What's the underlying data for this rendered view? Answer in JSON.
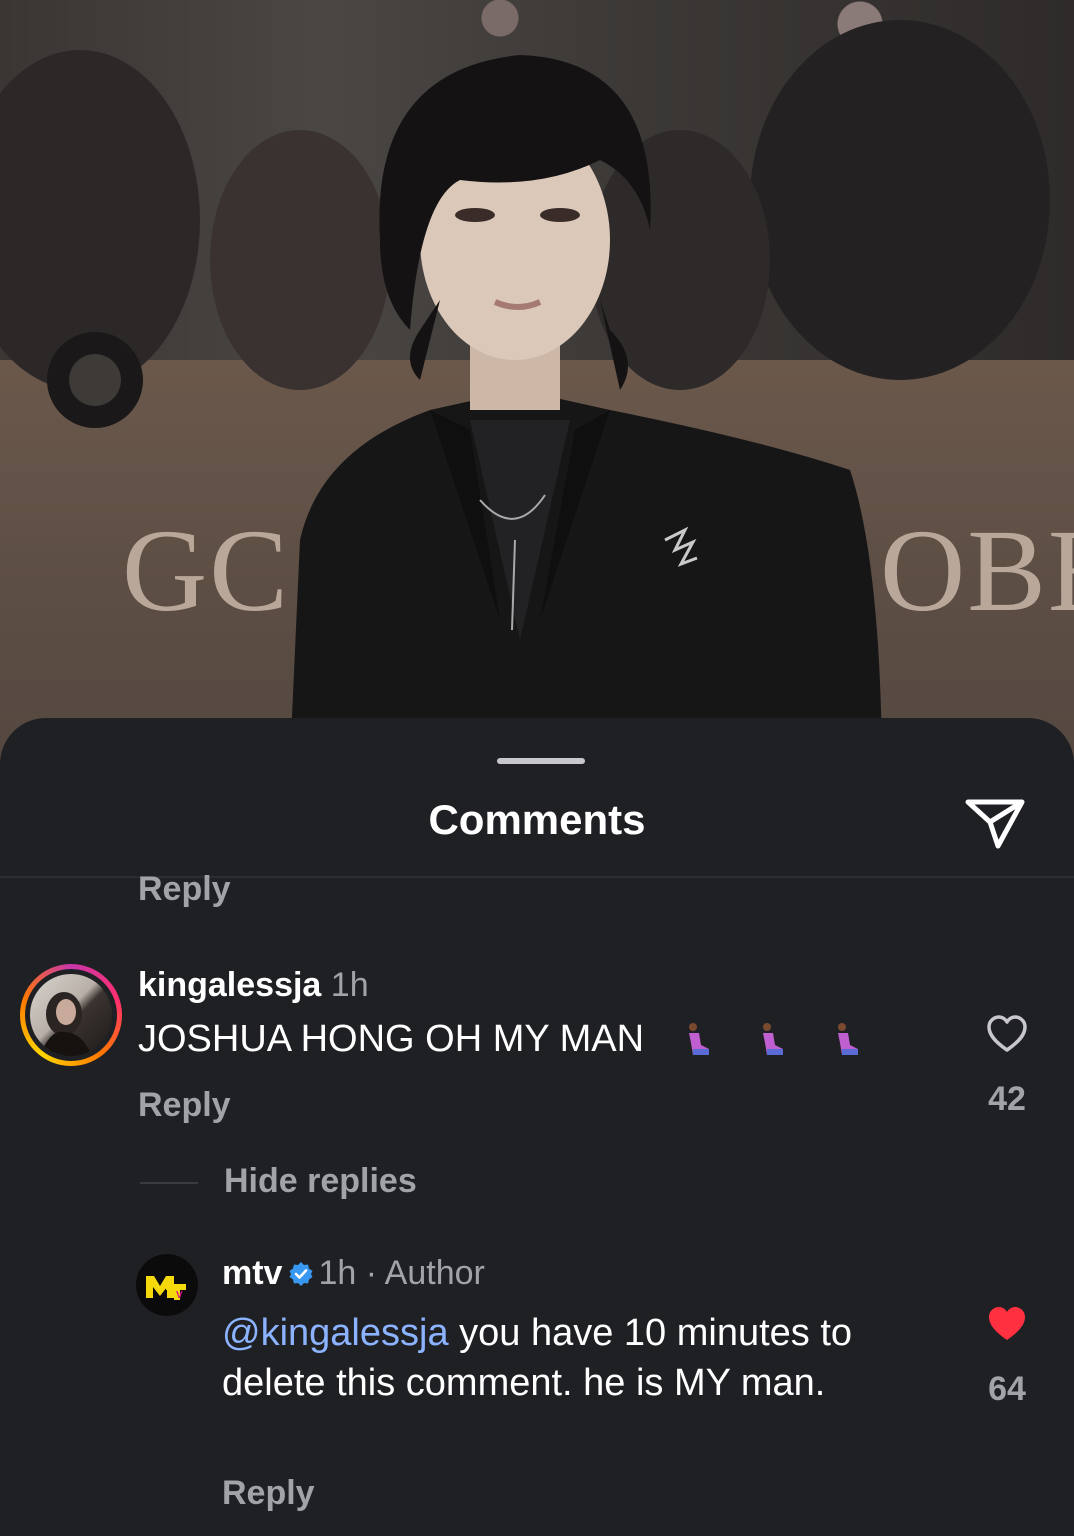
{
  "photo": {
    "board_text_left": "GC",
    "board_text_right": "OBE"
  },
  "sheet": {
    "title": "Comments",
    "share_icon": "paper-plane-icon"
  },
  "comments": [
    {
      "username": "kingalessja",
      "time": "1h",
      "text": "JOSHUA HONG OH MY MAN",
      "emoji": "person-kneeling",
      "reply_label": "Reply",
      "like_count": "42",
      "liked": false
    }
  ],
  "thread": {
    "prev_reply_label": "Reply",
    "hide_replies_label": "Hide replies"
  },
  "replies": [
    {
      "username": "mtv",
      "verified": true,
      "time": "1h",
      "separator": "·",
      "author_label": "Author",
      "mention": "@kingalessja",
      "text": " you have 10 minutes to delete this comment. he is MY man.",
      "reply_label": "Reply",
      "like_count": "64",
      "liked": true,
      "like_color": "#ff3040"
    }
  ],
  "colors": {
    "sheet_bg": "#1f2024",
    "secondary_text": "#a2a3a8",
    "mention": "#8cb3ff",
    "verified": "#3897f0"
  }
}
